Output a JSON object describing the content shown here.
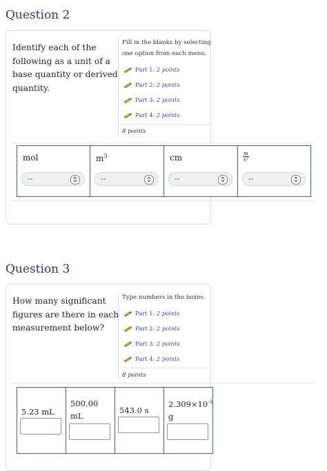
{
  "q2": {
    "title": "Question 2",
    "prompt": "Identify each of the following as a unit of a base quantity or derived quantity.",
    "instructions": "Fill in the blanks by selecting one option from each menu.",
    "parts": [
      {
        "label": "Part 1:",
        "points": "2 points"
      },
      {
        "label": "Part 2:",
        "points": "2 points"
      },
      {
        "label": "Part 3:",
        "points": "2 points"
      },
      {
        "label": "Part 4:",
        "points": "2 points"
      }
    ],
    "total": "8 points",
    "units": {
      "u1": "mol",
      "u2": "m",
      "u2_sup": "3",
      "u3": "cm",
      "u4_num": "m",
      "u4_den": "s²"
    },
    "select_value": "--"
  },
  "q3": {
    "title": "Question 3",
    "prompt": "How many significant figures are there in each measurement below?",
    "instructions": "Type numbers in the boxes.",
    "parts": [
      {
        "label": "Part 1:",
        "points": "2 points"
      },
      {
        "label": "Part 2:",
        "points": "2 points"
      },
      {
        "label": "Part 3:",
        "points": "2 points"
      },
      {
        "label": "Part 4:",
        "points": "2 points"
      }
    ],
    "total": "8 points",
    "measurements": {
      "m1": "5.23 mL",
      "m2_line1": "500.00",
      "m2_line2": "mL",
      "m3": "543.0 s",
      "m4_base": "2.309×10",
      "m4_sup": "-3",
      "m4_unit": "g"
    }
  }
}
